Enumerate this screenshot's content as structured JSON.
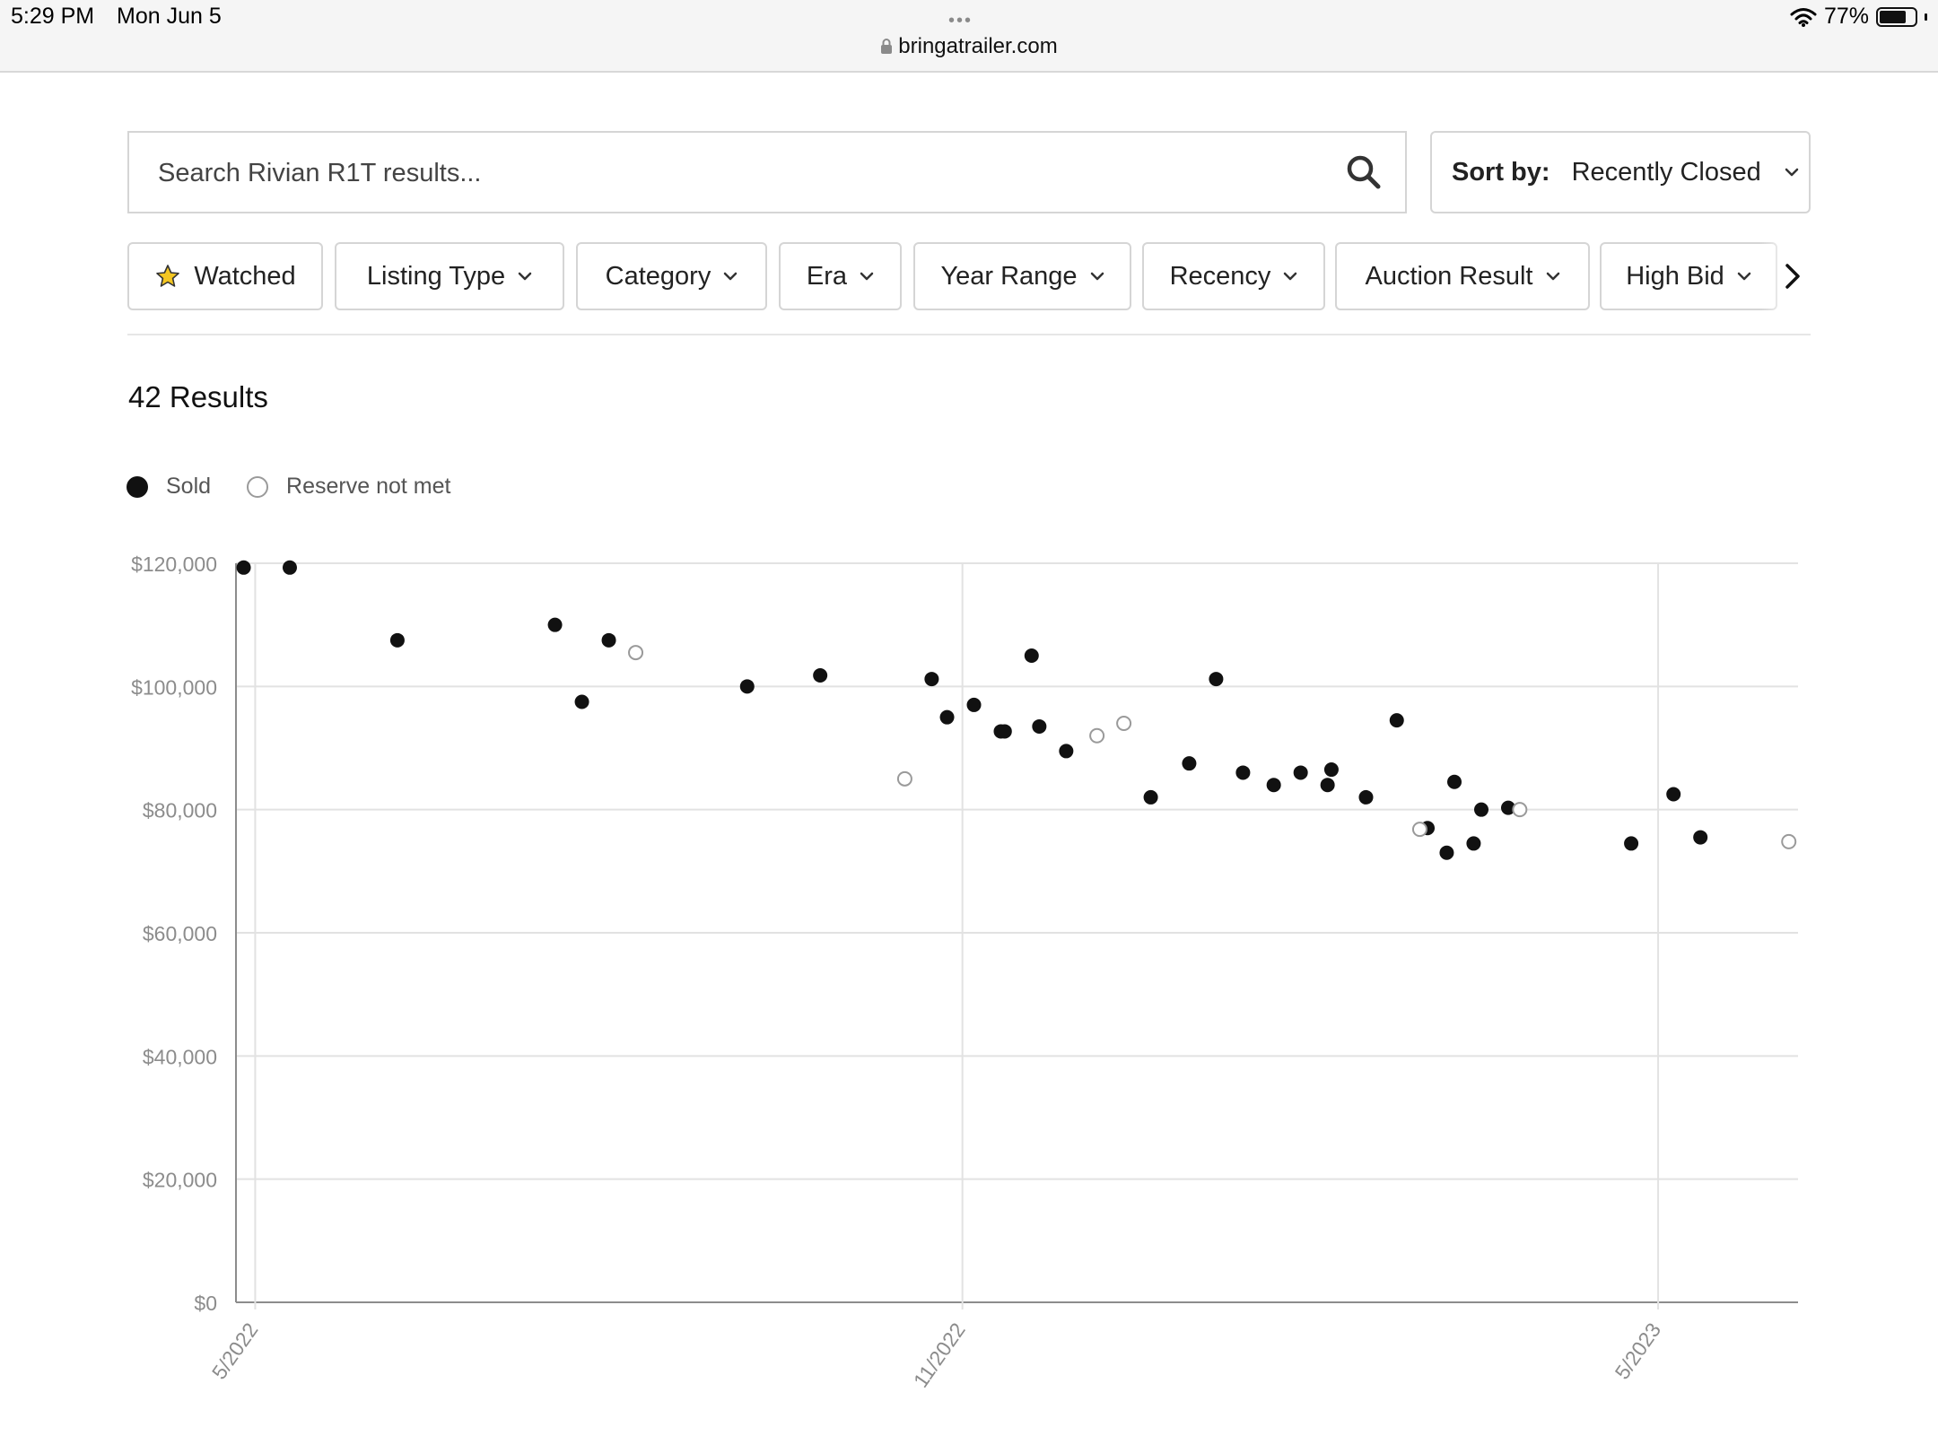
{
  "status": {
    "time": "5:29 PM",
    "date": "Mon Jun 5",
    "url": "bringatrailer.com",
    "battery": "77%",
    "battery_level": 0.77,
    "dots": "•••"
  },
  "search": {
    "placeholder": "Search Rivian R1T results..."
  },
  "sort": {
    "label": "Sort by:",
    "value": "Recently Closed"
  },
  "filters": [
    {
      "label": "Watched",
      "icon": "star-icon"
    },
    {
      "label": "Listing Type",
      "icon": "chevron-down-icon"
    },
    {
      "label": "Category",
      "icon": "chevron-down-icon"
    },
    {
      "label": "Era",
      "icon": "chevron-down-icon"
    },
    {
      "label": "Year Range",
      "icon": "chevron-down-icon"
    },
    {
      "label": "Recency",
      "icon": "chevron-down-icon"
    },
    {
      "label": "Auction Result",
      "icon": "chevron-down-icon"
    },
    {
      "label": "High Bid",
      "icon": "chevron-down-icon"
    }
  ],
  "results_count": "42 Results",
  "legend": {
    "sold": "Sold",
    "reserve": "Reserve not met"
  },
  "colors": {
    "sold": "#111111",
    "reserve_stroke": "#9a9a9a",
    "grid": "#e2e2e2",
    "star": "#f3c622"
  },
  "chart_data": {
    "type": "scatter",
    "title": "",
    "xlabel": "",
    "ylabel": "",
    "x_ticks": [
      "5/2022",
      "11/2022",
      "5/2023"
    ],
    "y_ticks": [
      "$0",
      "$20,000",
      "$40,000",
      "$60,000",
      "$80,000",
      "$100,000",
      "$120,000"
    ],
    "ylim": [
      0,
      120000
    ],
    "xlim": [
      "2022-04-26",
      "2023-06-05"
    ],
    "legend_position": "top-left",
    "series": [
      {
        "name": "Sold",
        "points": [
          {
            "x": "2022-04-28",
            "y": 119300
          },
          {
            "x": "2022-05-10",
            "y": 119300
          },
          {
            "x": "2022-06-07",
            "y": 107500
          },
          {
            "x": "2022-07-18",
            "y": 110000
          },
          {
            "x": "2022-07-25",
            "y": 97500
          },
          {
            "x": "2022-08-01",
            "y": 107500
          },
          {
            "x": "2022-09-06",
            "y": 100000
          },
          {
            "x": "2022-09-25",
            "y": 101800
          },
          {
            "x": "2022-10-24",
            "y": 101200
          },
          {
            "x": "2022-10-28",
            "y": 95000
          },
          {
            "x": "2022-11-04",
            "y": 97000
          },
          {
            "x": "2022-11-11",
            "y": 92700
          },
          {
            "x": "2022-11-12",
            "y": 92700
          },
          {
            "x": "2022-11-19",
            "y": 105000
          },
          {
            "x": "2022-11-21",
            "y": 93500
          },
          {
            "x": "2022-11-28",
            "y": 89500
          },
          {
            "x": "2022-12-20",
            "y": 82000
          },
          {
            "x": "2022-12-30",
            "y": 87500
          },
          {
            "x": "2023-01-06",
            "y": 101200
          },
          {
            "x": "2023-01-13",
            "y": 86000
          },
          {
            "x": "2023-01-21",
            "y": 84000
          },
          {
            "x": "2023-01-28",
            "y": 86000
          },
          {
            "x": "2023-02-04",
            "y": 84000
          },
          {
            "x": "2023-02-05",
            "y": 86500
          },
          {
            "x": "2023-02-14",
            "y": 82000
          },
          {
            "x": "2023-02-22",
            "y": 94500
          },
          {
            "x": "2023-03-02",
            "y": 77000
          },
          {
            "x": "2023-03-07",
            "y": 73000
          },
          {
            "x": "2023-03-09",
            "y": 84500
          },
          {
            "x": "2023-03-14",
            "y": 74500
          },
          {
            "x": "2023-03-16",
            "y": 80000
          },
          {
            "x": "2023-03-23",
            "y": 80300
          },
          {
            "x": "2023-04-24",
            "y": 74500
          },
          {
            "x": "2023-05-05",
            "y": 82500
          },
          {
            "x": "2023-05-12",
            "y": 75500
          }
        ]
      },
      {
        "name": "Reserve not met",
        "points": [
          {
            "x": "2022-08-08",
            "y": 105500
          },
          {
            "x": "2022-10-17",
            "y": 85000
          },
          {
            "x": "2022-12-06",
            "y": 92000
          },
          {
            "x": "2022-12-13",
            "y": 94000
          },
          {
            "x": "2023-02-28",
            "y": 76800
          },
          {
            "x": "2023-03-26",
            "y": 80000
          },
          {
            "x": "2023-06-04",
            "y": 74800
          }
        ]
      }
    ]
  }
}
